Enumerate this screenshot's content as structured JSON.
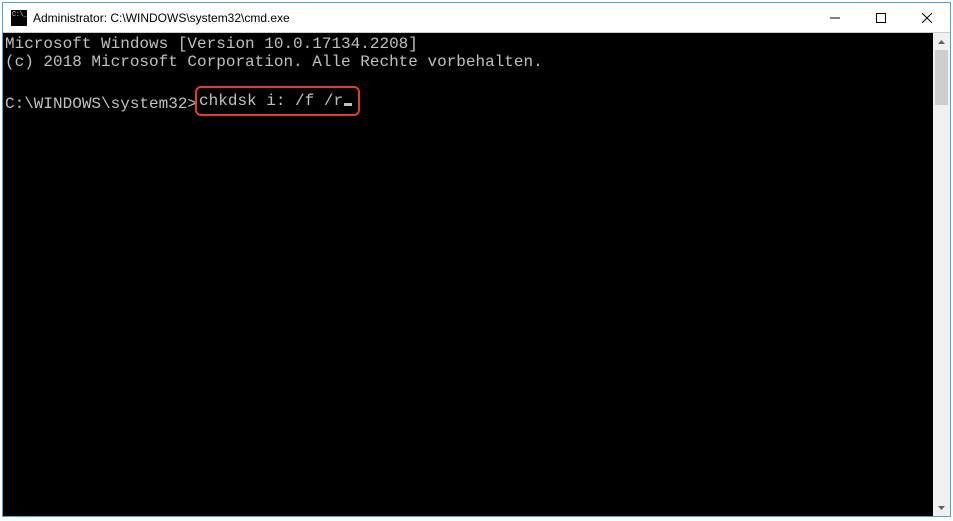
{
  "titlebar": {
    "title": "Administrator: C:\\WINDOWS\\system32\\cmd.exe"
  },
  "console": {
    "line1": "Microsoft Windows [Version 10.0.17134.2208]",
    "line2": "(c) 2018 Microsoft Corporation. Alle Rechte vorbehalten.",
    "blank": "",
    "prompt": "C:\\WINDOWS\\system32>",
    "command": "chkdsk i: /f /r"
  },
  "colors": {
    "highlight_border": "#e53935",
    "console_bg": "#000000",
    "console_fg": "#c0c0c0",
    "window_border": "#4aa3e0"
  }
}
